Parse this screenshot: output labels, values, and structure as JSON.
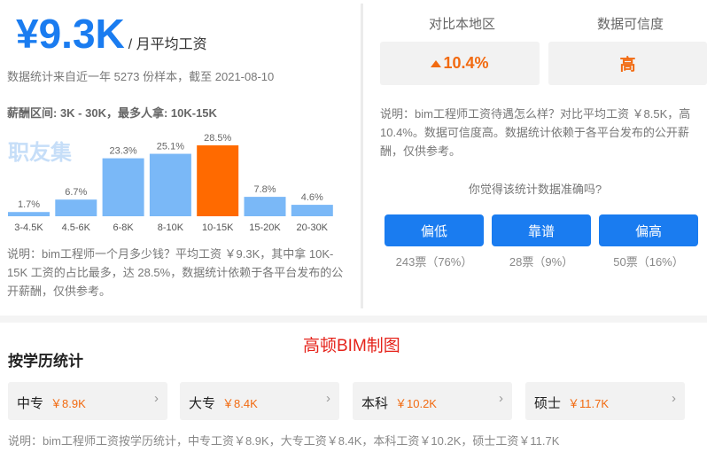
{
  "salary": {
    "value": "¥9.3K",
    "unit": "/ 月平均工资",
    "sample_text": "数据统计来自近一年 5273 份样本，截至 2021-08-10",
    "range_text": "薪酬区间: 3K - 30K，最多人拿: 10K-15K",
    "watermark": "职友集"
  },
  "chart_data": {
    "type": "bar",
    "categories": [
      "3-4.5K",
      "4.5-6K",
      "6-8K",
      "8-10K",
      "10-15K",
      "15-20K",
      "20-30K"
    ],
    "values": [
      1.7,
      6.7,
      23.3,
      25.1,
      28.5,
      7.8,
      4.6
    ],
    "value_labels": [
      "1.7%",
      "6.7%",
      "23.3%",
      "25.1%",
      "28.5%",
      "7.8%",
      "4.6%"
    ],
    "highlight_index": 4,
    "colors": {
      "normal": "#7ab8f7",
      "highlight": "#ff6a00"
    },
    "ylim": [
      0,
      28.5
    ]
  },
  "left_description": "说明：bim工程师一个月多少钱？平均工资 ￥9.3K，其中拿 10K-15K 工资的占比最多，达 28.5%，数据统计依赖于各平台发布的公开薪酬，仅供参考。",
  "compare": {
    "header1": "对比本地区",
    "header2": "数据可信度",
    "value1": "10.4%",
    "value2": "高",
    "description": "说明：bim工程师工资待遇怎么样？对比平均工资 ￥8.5K，高 10.4%。数据可信度高。数据统计依赖于各平台发布的公开薪酬，仅供参考。"
  },
  "vote": {
    "question": "你觉得该统计数据准确吗?",
    "options": [
      {
        "label": "偏低",
        "count": "243票（76%）"
      },
      {
        "label": "靠谱",
        "count": "28票（9%）"
      },
      {
        "label": "偏高",
        "count": "50票（16%）"
      }
    ]
  },
  "education": {
    "title": "按学历统计",
    "caption": "高顿BIM制图",
    "items": [
      {
        "name": "中专",
        "value": "￥8.9K"
      },
      {
        "name": "大专",
        "value": "￥8.4K"
      },
      {
        "name": "本科",
        "value": "￥10.2K"
      },
      {
        "name": "硕士",
        "value": "￥11.7K"
      }
    ],
    "description": "说明：bim工程师工资按学历统计，中专工资￥8.9K，大专工资￥8.4K，本科工资￥10.2K，硕士工资￥11.7K"
  },
  "colors": {
    "accent": "#1a7cf0",
    "orange": "#f26a10",
    "caption_red": "#e5221a"
  }
}
